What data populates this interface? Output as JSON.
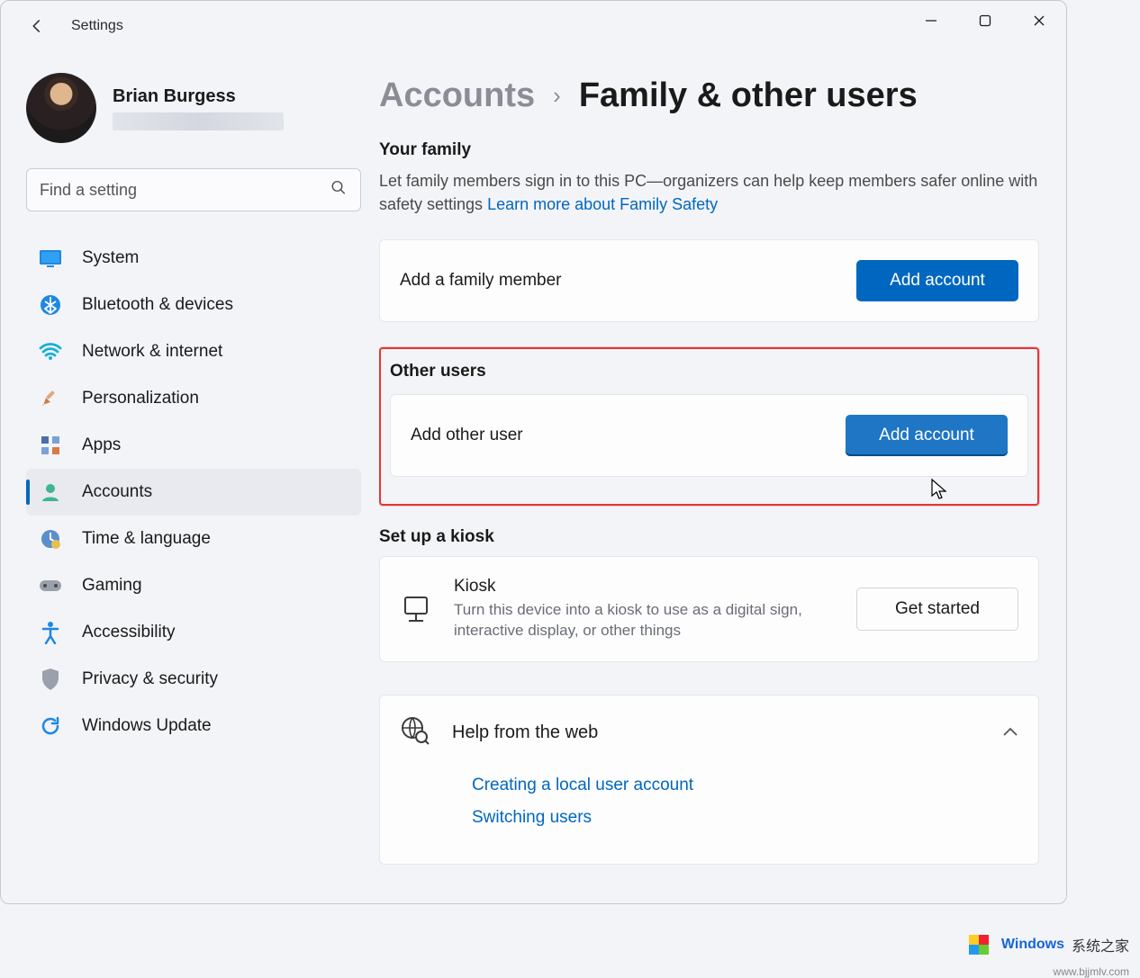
{
  "app": {
    "title": "Settings"
  },
  "profile": {
    "name": "Brian Burgess"
  },
  "search": {
    "placeholder": "Find a setting"
  },
  "sidebar": {
    "items": [
      {
        "label": "System"
      },
      {
        "label": "Bluetooth & devices"
      },
      {
        "label": "Network & internet"
      },
      {
        "label": "Personalization"
      },
      {
        "label": "Apps"
      },
      {
        "label": "Accounts"
      },
      {
        "label": "Time & language"
      },
      {
        "label": "Gaming"
      },
      {
        "label": "Accessibility"
      },
      {
        "label": "Privacy & security"
      },
      {
        "label": "Windows Update"
      }
    ]
  },
  "breadcrumb": {
    "parent": "Accounts",
    "current": "Family & other users"
  },
  "family": {
    "heading": "Your family",
    "desc_pre": "Let family members sign in to this PC—organizers can help keep members safer online with safety settings  ",
    "link": "Learn more about Family Safety",
    "card_label": "Add a family member",
    "button": "Add account"
  },
  "other": {
    "heading": "Other users",
    "card_label": "Add other user",
    "button": "Add account"
  },
  "kiosk": {
    "heading": "Set up a kiosk",
    "title": "Kiosk",
    "desc": "Turn this device into a kiosk to use as a digital sign, interactive display, or other things",
    "button": "Get started"
  },
  "help": {
    "title": "Help from the web",
    "links": [
      "Creating a local user account",
      "Switching users"
    ]
  },
  "watermark": {
    "t1": "Windows",
    "t2": "系统之家",
    "under": "www.bjjmlv.com"
  }
}
